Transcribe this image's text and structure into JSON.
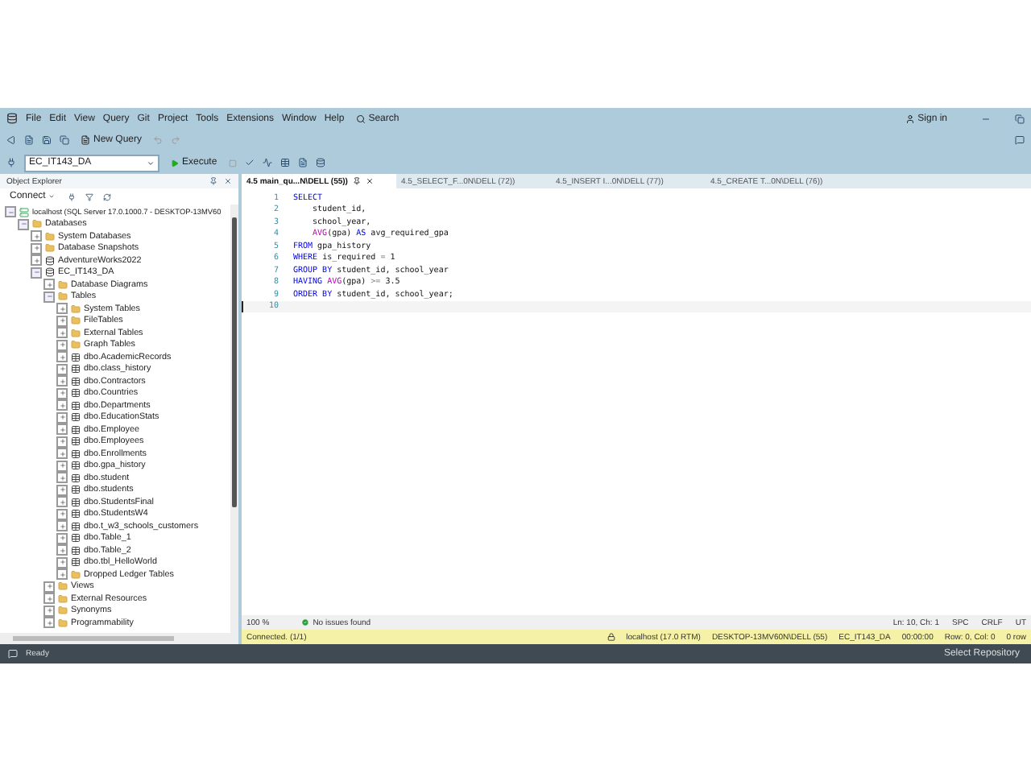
{
  "menu": [
    "File",
    "Edit",
    "View",
    "Query",
    "Git",
    "Project",
    "Tools",
    "Extensions",
    "Window",
    "Help"
  ],
  "search": {
    "label": "Search"
  },
  "sign_in": "Sign in",
  "toolbar": {
    "new_query": "New Query",
    "database": "EC_IT143_DA",
    "execute": "Execute"
  },
  "object_explorer": {
    "title": "Object Explorer",
    "connect": "Connect",
    "tree": [
      {
        "label": "localhost (SQL Server 17.0.1000.7 - DESKTOP-13MV60",
        "kind": "server",
        "expanded": true,
        "children": [
          {
            "label": "Databases",
            "kind": "folder",
            "expanded": true,
            "children": [
              {
                "label": "System Databases",
                "kind": "folder",
                "expanded": false
              },
              {
                "label": "Database Snapshots",
                "kind": "folder",
                "expanded": false
              },
              {
                "label": "AdventureWorks2022",
                "kind": "database",
                "expanded": false
              },
              {
                "label": "EC_IT143_DA",
                "kind": "database",
                "expanded": true,
                "children": [
                  {
                    "label": "Database Diagrams",
                    "kind": "folder",
                    "expanded": false
                  },
                  {
                    "label": "Tables",
                    "kind": "folder",
                    "expanded": true,
                    "children": [
                      {
                        "label": "System Tables",
                        "kind": "folder",
                        "expanded": false
                      },
                      {
                        "label": "FileTables",
                        "kind": "folder",
                        "expanded": false
                      },
                      {
                        "label": "External Tables",
                        "kind": "folder",
                        "expanded": false
                      },
                      {
                        "label": "Graph Tables",
                        "kind": "folder",
                        "expanded": false
                      },
                      {
                        "label": "dbo.AcademicRecords",
                        "kind": "table",
                        "expanded": false
                      },
                      {
                        "label": "dbo.class_history",
                        "kind": "table",
                        "expanded": false
                      },
                      {
                        "label": "dbo.Contractors",
                        "kind": "table",
                        "expanded": false
                      },
                      {
                        "label": "dbo.Countries",
                        "kind": "table",
                        "expanded": false
                      },
                      {
                        "label": "dbo.Departments",
                        "kind": "table",
                        "expanded": false
                      },
                      {
                        "label": "dbo.EducationStats",
                        "kind": "table",
                        "expanded": false
                      },
                      {
                        "label": "dbo.Employee",
                        "kind": "table",
                        "expanded": false
                      },
                      {
                        "label": "dbo.Employees",
                        "kind": "table",
                        "expanded": false
                      },
                      {
                        "label": "dbo.Enrollments",
                        "kind": "table",
                        "expanded": false
                      },
                      {
                        "label": "dbo.gpa_history",
                        "kind": "table",
                        "expanded": false
                      },
                      {
                        "label": "dbo.student",
                        "kind": "table",
                        "expanded": false
                      },
                      {
                        "label": "dbo.students",
                        "kind": "table",
                        "expanded": false
                      },
                      {
                        "label": "dbo.StudentsFinal",
                        "kind": "table",
                        "expanded": false
                      },
                      {
                        "label": "dbo.StudentsW4",
                        "kind": "table",
                        "expanded": false
                      },
                      {
                        "label": "dbo.t_w3_schools_customers",
                        "kind": "table",
                        "expanded": false
                      },
                      {
                        "label": "dbo.Table_1",
                        "kind": "table",
                        "expanded": false
                      },
                      {
                        "label": "dbo.Table_2",
                        "kind": "table",
                        "expanded": false
                      },
                      {
                        "label": "dbo.tbl_HelloWorld",
                        "kind": "table",
                        "expanded": false
                      },
                      {
                        "label": "Dropped Ledger Tables",
                        "kind": "folder",
                        "expanded": false
                      }
                    ]
                  },
                  {
                    "label": "Views",
                    "kind": "folder",
                    "expanded": false
                  },
                  {
                    "label": "External Resources",
                    "kind": "folder",
                    "expanded": false
                  },
                  {
                    "label": "Synonyms",
                    "kind": "folder",
                    "expanded": false
                  },
                  {
                    "label": "Programmability",
                    "kind": "folder",
                    "expanded": false
                  }
                ]
              }
            ]
          }
        ]
      }
    ]
  },
  "tabs": [
    {
      "label": "4.5 main_qu...N\\DELL (55))",
      "selected": true
    },
    {
      "label": "4.5_SELECT_F...0N\\DELL (72))",
      "selected": false
    },
    {
      "label": "4.5_INSERT I...0N\\DELL (77))",
      "selected": false
    },
    {
      "label": "4.5_CREATE T...0N\\DELL (76))",
      "selected": false
    }
  ],
  "code": [
    {
      "number": "1",
      "tokens": [
        {
          "text": "SELECT",
          "kind": "keyword"
        }
      ]
    },
    {
      "number": "2",
      "tokens": [
        {
          "text": "    student_id,",
          "kind": "plain"
        }
      ]
    },
    {
      "number": "3",
      "tokens": [
        {
          "text": "    school_year,",
          "kind": "plain"
        }
      ]
    },
    {
      "number": "4",
      "tokens": [
        {
          "text": "    AVG",
          "kind": "function"
        },
        {
          "text": "(gpa) ",
          "kind": "plain"
        },
        {
          "text": "AS",
          "kind": "keyword"
        },
        {
          "text": " avg_required_gpa",
          "kind": "plain"
        }
      ]
    },
    {
      "number": "5",
      "tokens": [
        {
          "text": "FROM",
          "kind": "keyword"
        },
        {
          "text": " gpa_history",
          "kind": "plain"
        }
      ]
    },
    {
      "number": "6",
      "tokens": [
        {
          "text": "WHERE",
          "kind": "keyword"
        },
        {
          "text": " is_required ",
          "kind": "plain"
        },
        {
          "text": "=",
          "kind": "operator"
        },
        {
          "text": " 1",
          "kind": "plain"
        }
      ]
    },
    {
      "number": "7",
      "tokens": [
        {
          "text": "GROUP BY",
          "kind": "keyword"
        },
        {
          "text": " student_id, school_year",
          "kind": "plain"
        }
      ]
    },
    {
      "number": "8",
      "tokens": [
        {
          "text": "HAVING ",
          "kind": "keyword"
        },
        {
          "text": "AVG",
          "kind": "function"
        },
        {
          "text": "(gpa) ",
          "kind": "plain"
        },
        {
          "text": ">=",
          "kind": "operator"
        },
        {
          "text": " 3.5",
          "kind": "plain"
        }
      ]
    },
    {
      "number": "9",
      "tokens": [
        {
          "text": "ORDER BY",
          "kind": "keyword"
        },
        {
          "text": " student_id, school_year;",
          "kind": "plain"
        }
      ]
    },
    {
      "number": "10"
    }
  ],
  "editor_status": {
    "zoom": "100 %",
    "issues": "No issues found",
    "position": "Ln: 10, Ch: 1",
    "whitespace": "SPC",
    "line_ending": "CRLF",
    "encoding": "UT"
  },
  "connection_bar": {
    "status": "Connected. (1/1)",
    "items": [
      "localhost (17.0 RTM)",
      "DESKTOP-13MV60N\\DELL (55)",
      "EC_IT143_DA",
      "00:00:00",
      "Row: 0, Col: 0",
      "0 row"
    ]
  },
  "status_bar": {
    "state": "Ready",
    "repository": "Select Repository"
  }
}
